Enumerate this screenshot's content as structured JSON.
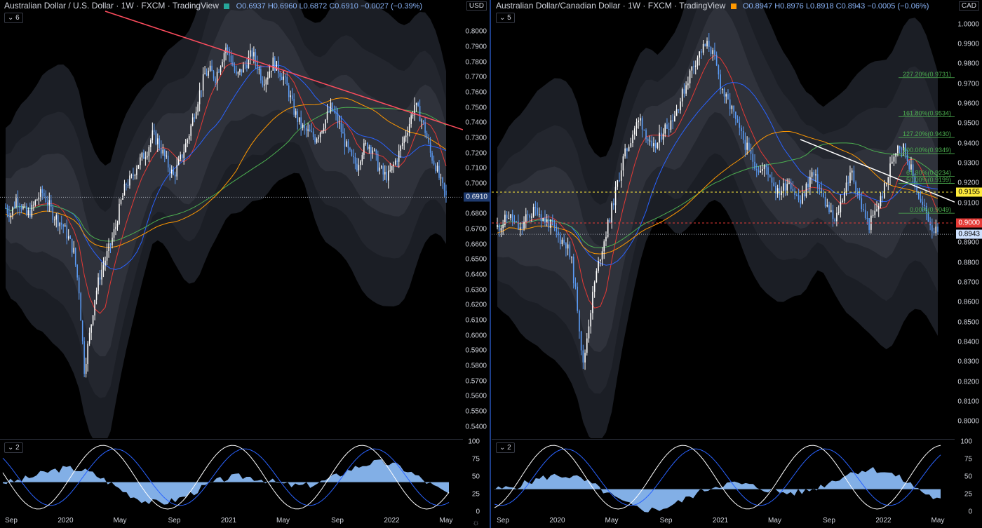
{
  "left": {
    "header": {
      "symbol": "Australian Dollar / U.S. Dollar",
      "interval": "1W",
      "exchange": "FXCM",
      "source": "TradingView",
      "flag_color": "#26a69a",
      "ohlc": "O0.6937  H0.6960  L0.6872  C0.6910  −0.0027 (−0.39%)"
    },
    "collapse_main": "6",
    "collapse_osc": "2",
    "currency": "USD",
    "last_price": "0.6910",
    "osc_ticks": [
      "100",
      "75",
      "50",
      "25",
      "0"
    ]
  },
  "right": {
    "header": {
      "symbol": "Australian Dollar/Canadian Dollar",
      "interval": "1W",
      "exchange": "FXCM",
      "source": "TradingView",
      "flag_color": "#ff9800",
      "ohlc": "O0.8947  H0.8976  L0.8918  C0.8943  −0.0005 (−0.06%)"
    },
    "collapse_main": "5",
    "collapse_osc": "2",
    "currency": "CAD",
    "last_price": "0.8943",
    "tag_yellow": "0.9155",
    "tag_red": "0.9000",
    "osc_ticks": [
      "100",
      "75",
      "50",
      "25",
      "0"
    ],
    "fib_labels": [
      {
        "text": "227.20%(0.9731)",
        "value": 0.9731
      },
      {
        "text": "161.80%(0.9534)",
        "value": 0.9534
      },
      {
        "text": "127.20%(0.9430)",
        "value": 0.943
      },
      {
        "text": "100.00%(0.9349)",
        "value": 0.9349
      },
      {
        "text": "61.80%(0.9234)",
        "value": 0.9234
      },
      {
        "text": "50.00%(0.9199)",
        "value": 0.9199
      },
      {
        "text": "0.00%(0.9049)",
        "value": 0.9049
      }
    ]
  },
  "colors": {
    "up": "#ffffff",
    "down": "#5b9cf6",
    "red_ma": "#e53935",
    "blue_ma": "#2962ff",
    "green_ma": "#4caf50",
    "orange_ma": "#ff9800",
    "trendline_left": "#ff4d5e",
    "trendline_right": "#ffffff",
    "fib": "#4caf50",
    "band": "#2a2e39"
  },
  "chart_data": [
    {
      "type": "candlestick",
      "title": "Australian Dollar / U.S. Dollar · 1W · FXCM",
      "x_ticks": [
        "Sep",
        "2020",
        "May",
        "Sep",
        "2021",
        "May",
        "Sep",
        "2022",
        "May"
      ],
      "y_ticks": [
        0.54,
        0.55,
        0.56,
        0.57,
        0.58,
        0.59,
        0.6,
        0.61,
        0.62,
        0.63,
        0.64,
        0.65,
        0.66,
        0.67,
        0.68,
        0.69,
        0.7,
        0.71,
        0.72,
        0.73,
        0.74,
        0.75,
        0.76,
        0.77,
        0.78,
        0.79,
        0.8
      ],
      "ylim": [
        0.537,
        0.808
      ],
      "close_path": [
        0.684,
        0.68,
        0.69,
        0.686,
        0.679,
        0.683,
        0.69,
        0.694,
        0.688,
        0.68,
        0.676,
        0.672,
        0.664,
        0.655,
        0.63,
        0.578,
        0.6,
        0.625,
        0.64,
        0.65,
        0.66,
        0.672,
        0.688,
        0.7,
        0.703,
        0.712,
        0.717,
        0.722,
        0.732,
        0.728,
        0.72,
        0.712,
        0.705,
        0.713,
        0.722,
        0.733,
        0.747,
        0.76,
        0.772,
        0.774,
        0.77,
        0.78,
        0.79,
        0.782,
        0.77,
        0.775,
        0.78,
        0.786,
        0.778,
        0.768,
        0.772,
        0.78,
        0.775,
        0.77,
        0.76,
        0.748,
        0.74,
        0.735,
        0.733,
        0.73,
        0.735,
        0.742,
        0.75,
        0.744,
        0.735,
        0.724,
        0.716,
        0.712,
        0.722,
        0.726,
        0.723,
        0.712,
        0.706,
        0.705,
        0.712,
        0.72,
        0.73,
        0.74,
        0.752,
        0.745,
        0.735,
        0.72,
        0.712,
        0.7,
        0.691
      ],
      "trendline": {
        "from": [
          0.806,
          "2019-08"
        ],
        "to": [
          0.737,
          "2022-05"
        ]
      },
      "oscillator": {
        "ylim": [
          0,
          100
        ],
        "y_ticks": [
          0,
          25,
          50,
          75,
          100
        ],
        "histogram_baseline": 43
      }
    },
    {
      "type": "candlestick",
      "title": "Australian Dollar/Canadian Dollar · 1W · FXCM",
      "x_ticks": [
        "Sep",
        "2020",
        "May",
        "Sep",
        "2021",
        "May",
        "Sep",
        "2022",
        "May"
      ],
      "y_ticks": [
        0.8,
        0.81,
        0.82,
        0.83,
        0.84,
        0.85,
        0.86,
        0.87,
        0.88,
        0.89,
        0.9,
        0.91,
        0.92,
        0.93,
        0.94,
        0.95,
        0.96,
        0.97,
        0.98,
        0.99,
        1.0
      ],
      "ylim": [
        0.797,
        1.003
      ],
      "close_path": [
        0.898,
        0.9,
        0.904,
        0.9,
        0.896,
        0.902,
        0.905,
        0.907,
        0.902,
        0.9,
        0.896,
        0.892,
        0.89,
        0.88,
        0.858,
        0.828,
        0.85,
        0.87,
        0.884,
        0.895,
        0.907,
        0.92,
        0.932,
        0.94,
        0.948,
        0.952,
        0.945,
        0.936,
        0.94,
        0.947,
        0.95,
        0.955,
        0.962,
        0.97,
        0.978,
        0.984,
        0.988,
        0.99,
        0.982,
        0.97,
        0.962,
        0.957,
        0.948,
        0.942,
        0.935,
        0.93,
        0.926,
        0.928,
        0.922,
        0.915,
        0.918,
        0.922,
        0.915,
        0.91,
        0.918,
        0.925,
        0.92,
        0.912,
        0.906,
        0.9,
        0.91,
        0.92,
        0.925,
        0.915,
        0.905,
        0.899,
        0.905,
        0.912,
        0.92,
        0.932,
        0.94,
        0.938,
        0.93,
        0.92,
        0.91,
        0.905,
        0.898,
        0.894
      ],
      "oscillator": {
        "ylim": [
          0,
          100
        ],
        "y_ticks": [
          0,
          25,
          50,
          75,
          100
        ],
        "histogram_baseline": 33
      }
    }
  ]
}
